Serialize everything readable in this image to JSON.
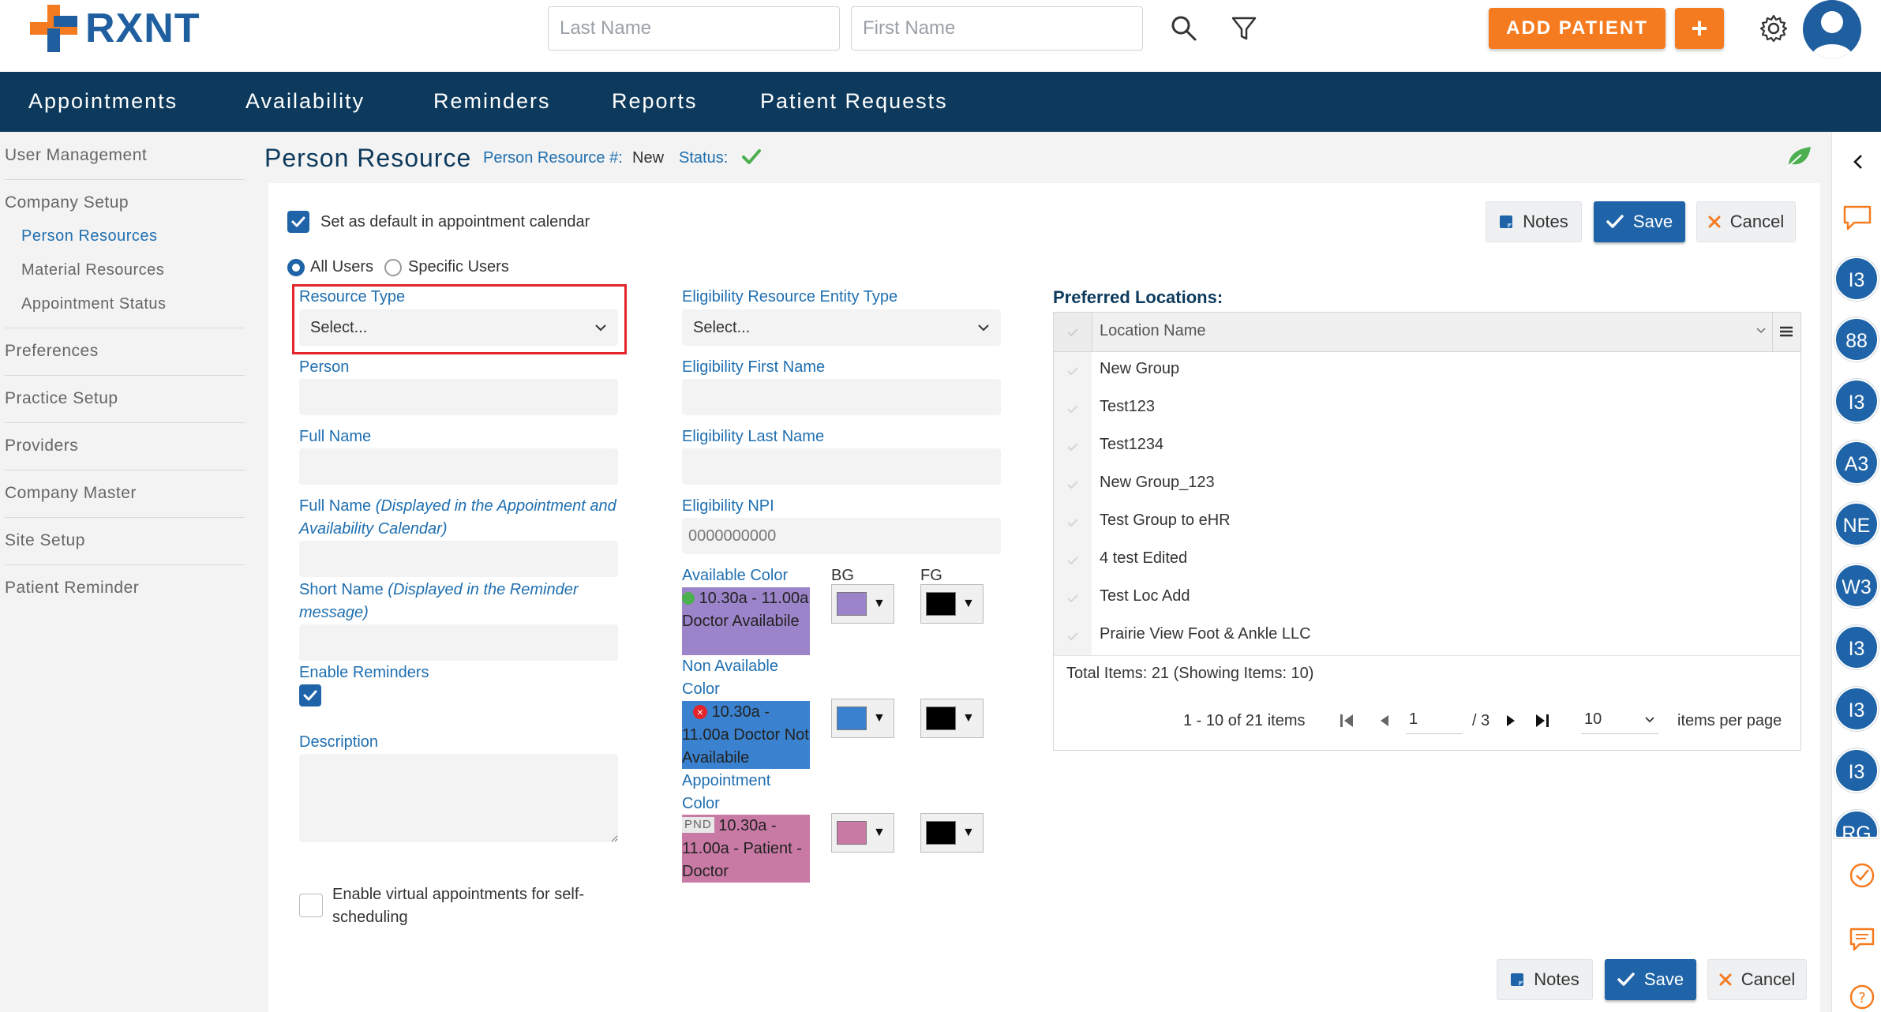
{
  "header": {
    "logo_text": "RXNT",
    "last_name_placeholder": "Last Name",
    "first_name_placeholder": "First Name",
    "add_patient_label": "ADD PATIENT",
    "plus_label": "+"
  },
  "nav": {
    "items": [
      "Appointments",
      "Availability",
      "Reminders",
      "Reports",
      "Patient Requests"
    ]
  },
  "sidebar": {
    "user_management": "User Management",
    "company_setup": "Company Setup",
    "person_resources": "Person Resources",
    "material_resources": "Material Resources",
    "appointment_status": "Appointment Status",
    "preferences": "Preferences",
    "practice_setup": "Practice Setup",
    "providers": "Providers",
    "company_master": "Company Master",
    "site_setup": "Site Setup",
    "patient_reminder": "Patient Reminder"
  },
  "page": {
    "title": "Person Resource",
    "resource_no_label": "Person Resource #:",
    "resource_no_value": "New",
    "status_label": "Status:"
  },
  "form": {
    "default_calendar_label": "Set as default in appointment calendar",
    "all_users_label": "All Users",
    "specific_users_label": "Specific Users",
    "resource_type_label": "Resource Type",
    "resource_type_value": "Select...",
    "person_label": "Person",
    "full_name_label": "Full Name",
    "full_name_display_label": "Full Name",
    "full_name_display_hint": "(Displayed in the Appointment and Availability Calendar)",
    "short_name_label": "Short Name",
    "short_name_hint": "(Displayed in the Reminder message)",
    "enable_reminders_label": "Enable Reminders",
    "description_label": "Description",
    "virtual_label": "Enable virtual appointments for self-scheduling",
    "elig_entity_label": "Eligibility Resource Entity Type",
    "elig_entity_value": "Select...",
    "elig_first_label": "Eligibility First Name",
    "elig_last_label": "Eligibility Last Name",
    "elig_npi_label": "Eligibility NPI",
    "elig_npi_value": "0000000000"
  },
  "colors": {
    "available_label": "Available Color",
    "bg_label": "BG",
    "fg_label": "FG",
    "available_text": "10.30a - 11.00a Doctor Availabile",
    "non_available_label": "Non Available Color",
    "non_available_text": "10.30a - 11.00a Doctor Not Availabile",
    "appointment_label": "Appointment Color",
    "appointment_badge": "PND",
    "appointment_text": "10.30a - 11.00a - Patient - Doctor",
    "available_bg": "#9b84c9",
    "non_available_bg": "#3a82cf",
    "appointment_bg": "#c879a4",
    "fg": "#000000"
  },
  "buttons": {
    "notes": "Notes",
    "save": "Save",
    "cancel": "Cancel"
  },
  "locations": {
    "title": "Preferred Locations:",
    "column": "Location Name",
    "rows": [
      "New Group",
      "Test123",
      "Test1234",
      "New Group_123",
      "Test Group to eHR",
      "4 test Edited",
      "Test Loc Add",
      "Prairie View Foot & Ankle LLC"
    ],
    "total": "Total Items: 21 (Showing Items: 10)",
    "range": "1 - 10 of 21 items",
    "page_value": "1",
    "page_total": "/ 3",
    "page_size": "10",
    "per_page": "items per page"
  },
  "rail": {
    "badges": [
      "I3",
      "88",
      "I3",
      "A3",
      "NE",
      "W3",
      "I3",
      "I3",
      "I3",
      "RG"
    ]
  },
  "theme": {
    "navy": "#0d3a5c",
    "blue": "#1f64a8",
    "orange": "#f47b20",
    "green": "#4caf50"
  }
}
